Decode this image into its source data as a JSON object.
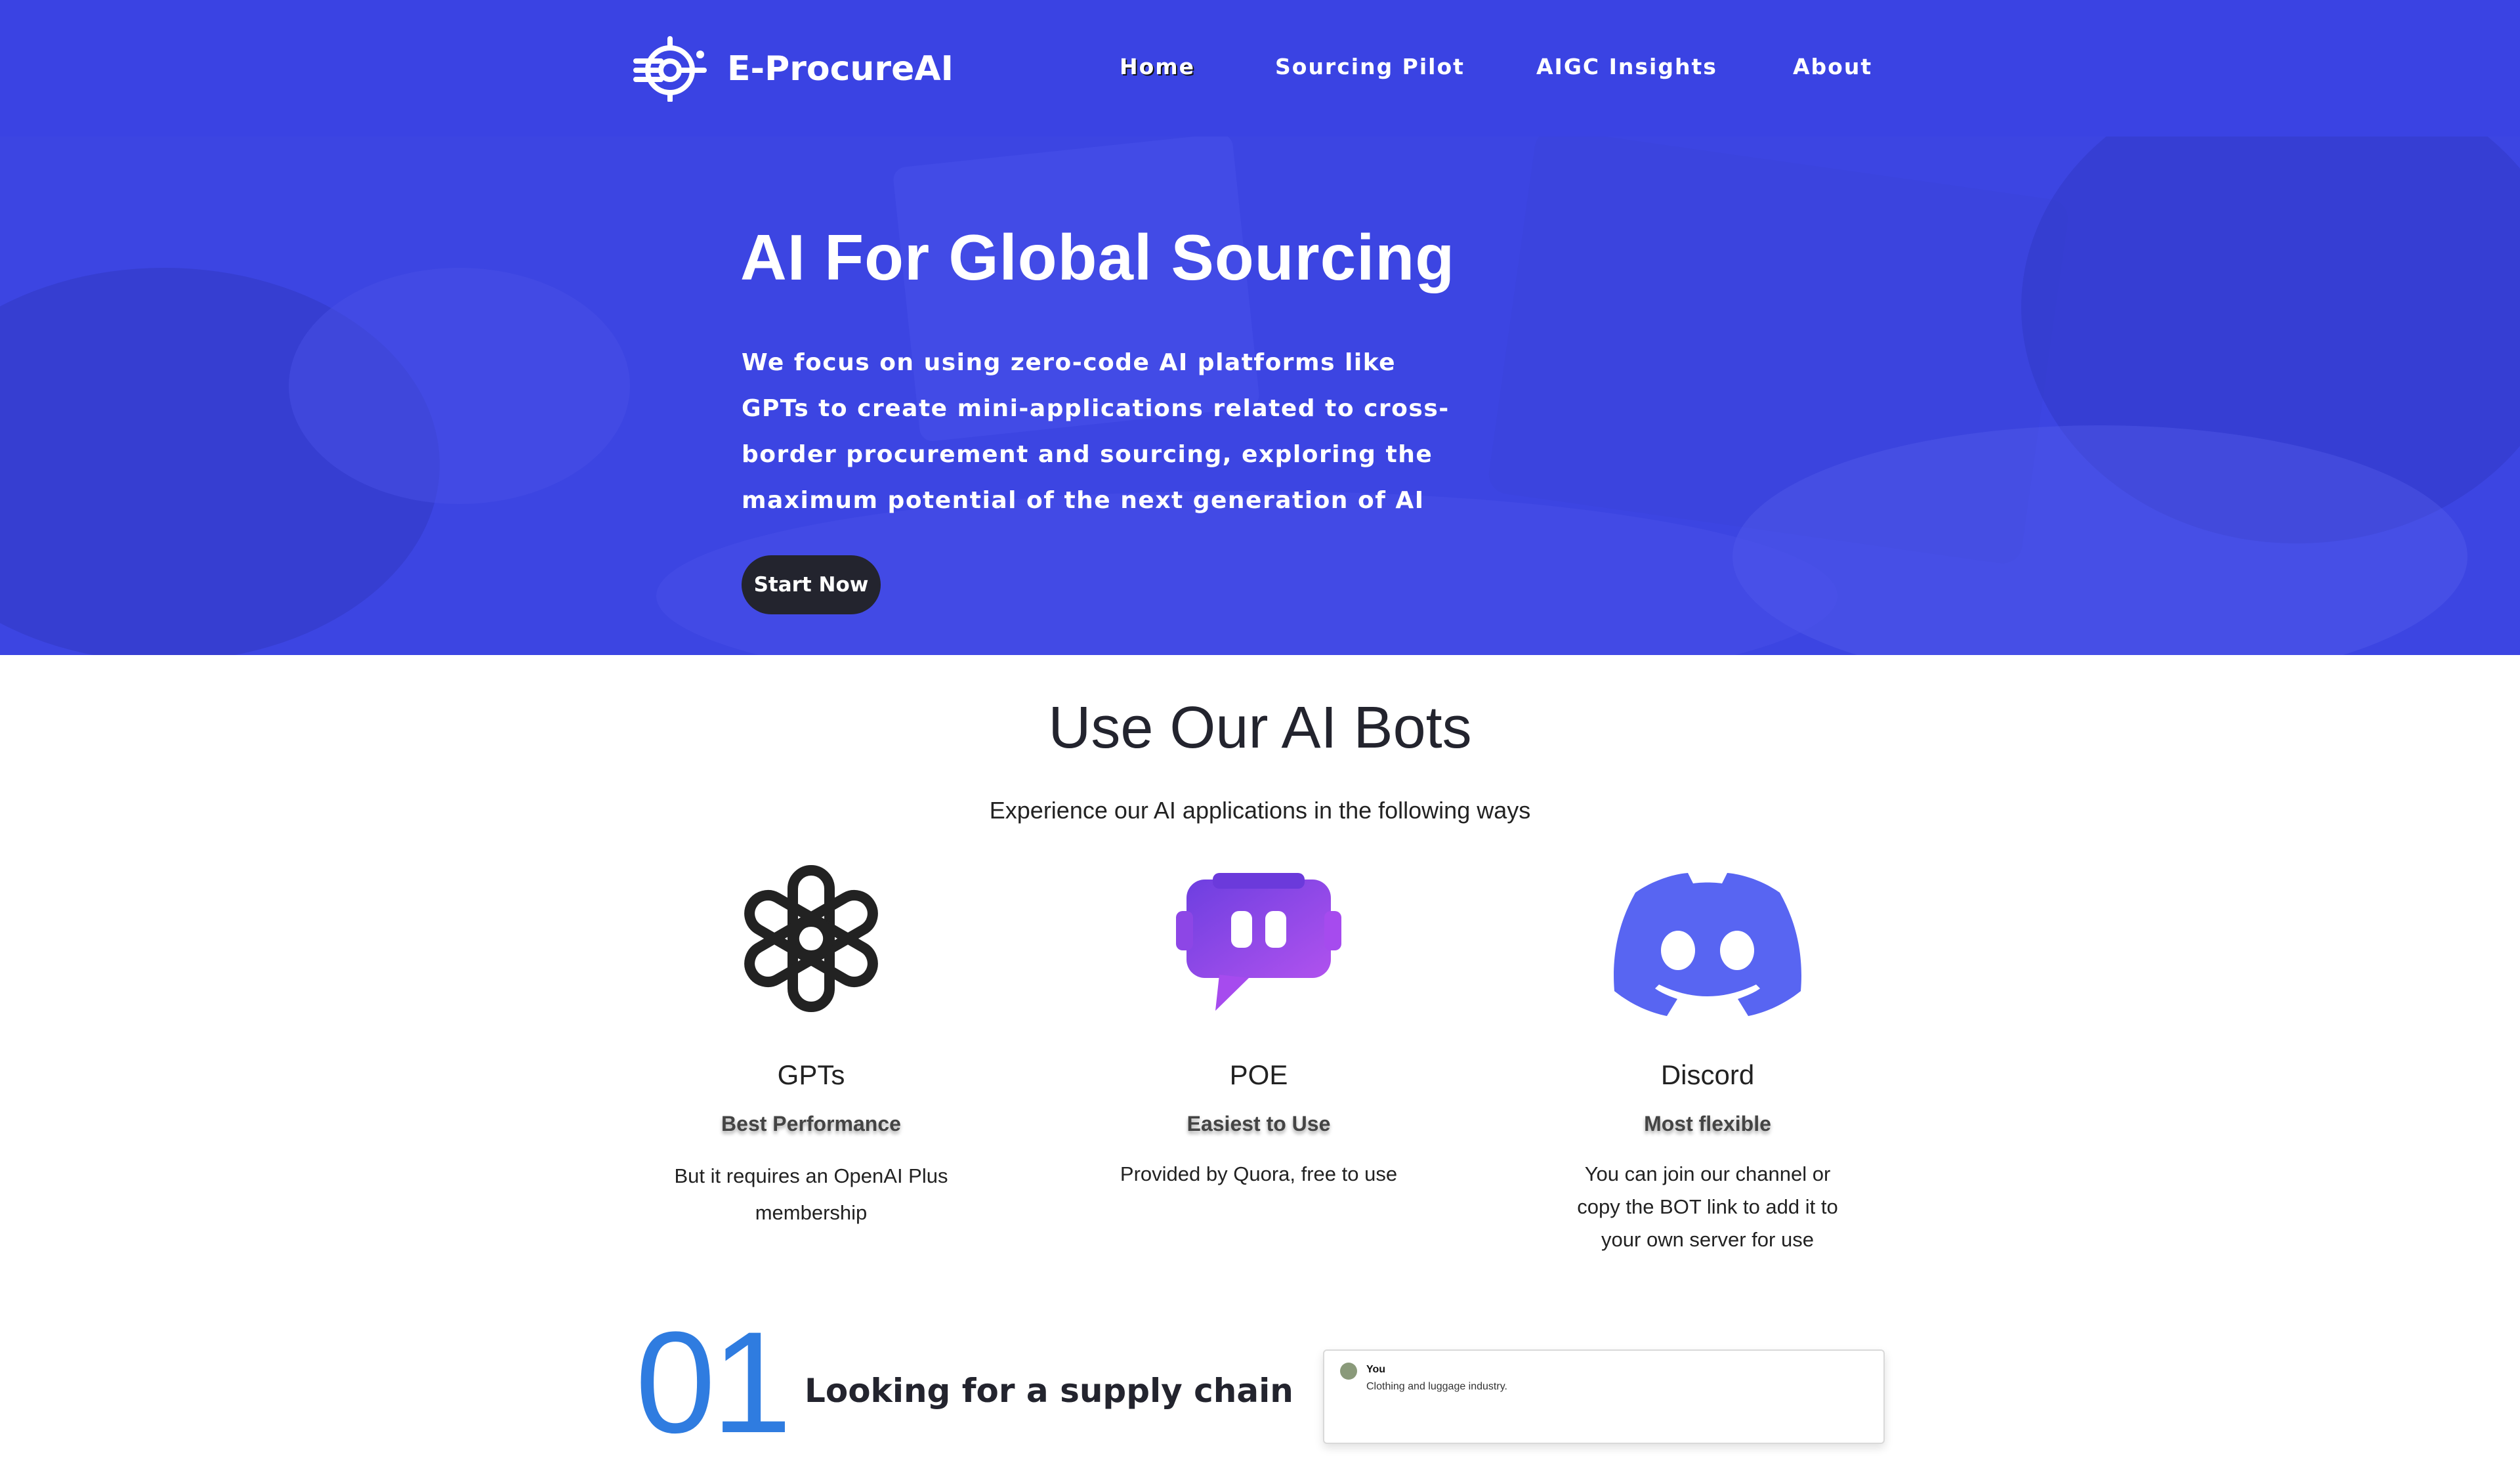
{
  "header": {
    "brand": "E-ProcureAI",
    "logo_icon": "radar-chip-icon",
    "nav": [
      {
        "label": "Home",
        "active": true
      },
      {
        "label": "Sourcing Pilot",
        "active": false
      },
      {
        "label": "AIGC Insights",
        "active": false
      },
      {
        "label": "About",
        "active": false
      }
    ]
  },
  "hero": {
    "title": "AI For Global Sourcing",
    "description": "We focus on using zero-code AI platforms like GPTs to create mini-applications related to cross-border procurement and sourcing, exploring the maximum potential of the next generation of AI",
    "cta": "Start Now"
  },
  "bots": {
    "title": "Use Our AI Bots",
    "subtitle": "Experience our AI applications in the following ways",
    "items": [
      {
        "icon": "openai-icon",
        "name": "GPTs",
        "tag": "Best Performance",
        "desc": "But it requires an OpenAI Plus membership"
      },
      {
        "icon": "poe-icon",
        "name": "POE",
        "tag": "Easiest to Use",
        "desc": "Provided by Quora, free to use"
      },
      {
        "icon": "discord-icon",
        "name": "Discord",
        "tag": "Most flexible",
        "desc": "You can join our channel or copy the BOT link to add it to your own server for use"
      }
    ]
  },
  "step1": {
    "number": "01",
    "title": "Looking for a supply chain",
    "chat": {
      "user": "You",
      "message": "Clothing and luggage industry."
    }
  },
  "colors": {
    "header_bg": "#3a43e3",
    "hero_bg": "#3c45e2",
    "button_bg": "#23242e",
    "discord": "#5865f2",
    "poe": "#8b45e8",
    "step_number": "#2f7ce0"
  }
}
